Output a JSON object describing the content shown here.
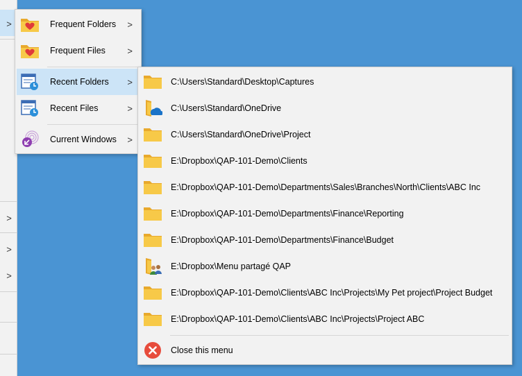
{
  "main_menu": {
    "items": [
      {
        "label": "Frequent Folders",
        "icon": "folder-heart-icon"
      },
      {
        "label": "Frequent Files",
        "icon": "folder-heart-icon"
      },
      {
        "label": "Recent Folders",
        "icon": "recent-folders-icon"
      },
      {
        "label": "Recent Files",
        "icon": "recent-files-icon"
      },
      {
        "label": "Current Windows",
        "icon": "current-windows-icon"
      }
    ],
    "submenu_arrow": ">"
  },
  "recent_folders_menu": {
    "items": [
      {
        "label": "C:\\Users\\Standard\\Desktop\\Captures",
        "icon": "folder-icon"
      },
      {
        "label": "C:\\Users\\Standard\\OneDrive",
        "icon": "onedrive-folder-icon"
      },
      {
        "label": "C:\\Users\\Standard\\OneDrive\\Project",
        "icon": "folder-icon"
      },
      {
        "label": "E:\\Dropbox\\QAP-101-Demo\\Clients",
        "icon": "folder-icon"
      },
      {
        "label": "E:\\Dropbox\\QAP-101-Demo\\Departments\\Sales\\Branches\\North\\Clients\\ABC Inc",
        "icon": "folder-icon"
      },
      {
        "label": "E:\\Dropbox\\QAP-101-Demo\\Departments\\Finance\\Reporting",
        "icon": "folder-icon"
      },
      {
        "label": "E:\\Dropbox\\QAP-101-Demo\\Departments\\Finance\\Budget",
        "icon": "folder-icon"
      },
      {
        "label": "E:\\Dropbox\\Menu partagé QAP",
        "icon": "shared-folder-icon"
      },
      {
        "label": "E:\\Dropbox\\QAP-101-Demo\\Clients\\ABC Inc\\Projects\\My Pet project\\Project Budget",
        "icon": "folder-icon"
      },
      {
        "label": "E:\\Dropbox\\QAP-101-Demo\\Clients\\ABC Inc\\Projects\\Project ABC",
        "icon": "folder-icon"
      }
    ],
    "close_label": "Close this menu"
  },
  "colors": {
    "desktop": "#4a94d3",
    "menu_bg": "#f2f2f2",
    "highlight": "#cce4f7",
    "folder": "#f4c84a",
    "close_red": "#e74c3c"
  }
}
